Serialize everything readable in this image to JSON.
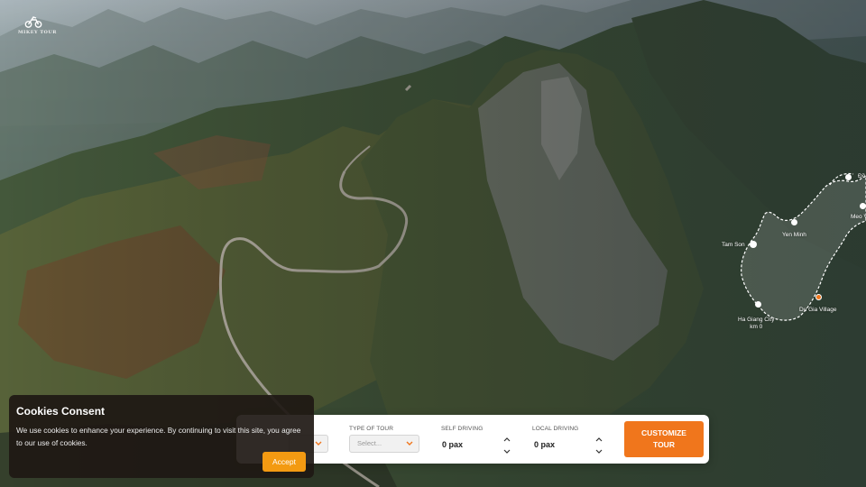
{
  "brand": {
    "logo_text": "MIKEY TOUR"
  },
  "map": {
    "labels": {
      "dong_van": "Đồ",
      "meo_vac": "Meo V",
      "tam_son": "Tam Son",
      "yen_minh": "Yen Minh",
      "ha_giang_line1": "Ha Giang City",
      "ha_giang_line2": "km 0",
      "du_gia": "Du Gia Village"
    }
  },
  "booking": {
    "type_of_tour": {
      "label": "TYPE OF TOUR",
      "placeholder": "Select..."
    },
    "self_driving": {
      "label": "SELF DRIVING",
      "value": "0 pax"
    },
    "local_driving": {
      "label": "LOCAL DRIVING",
      "value": "0 pax"
    },
    "customize_line1": "CUSTOMIZE",
    "customize_line2": "TOUR"
  },
  "cookies": {
    "title": "Cookies Consent",
    "text": "We use cookies to enhance your experience. By continuing to visit this site, you agree to our use of cookies.",
    "accept_label": "Accept"
  },
  "colors": {
    "accent": "#f0761c",
    "accept": "#f39a12"
  }
}
